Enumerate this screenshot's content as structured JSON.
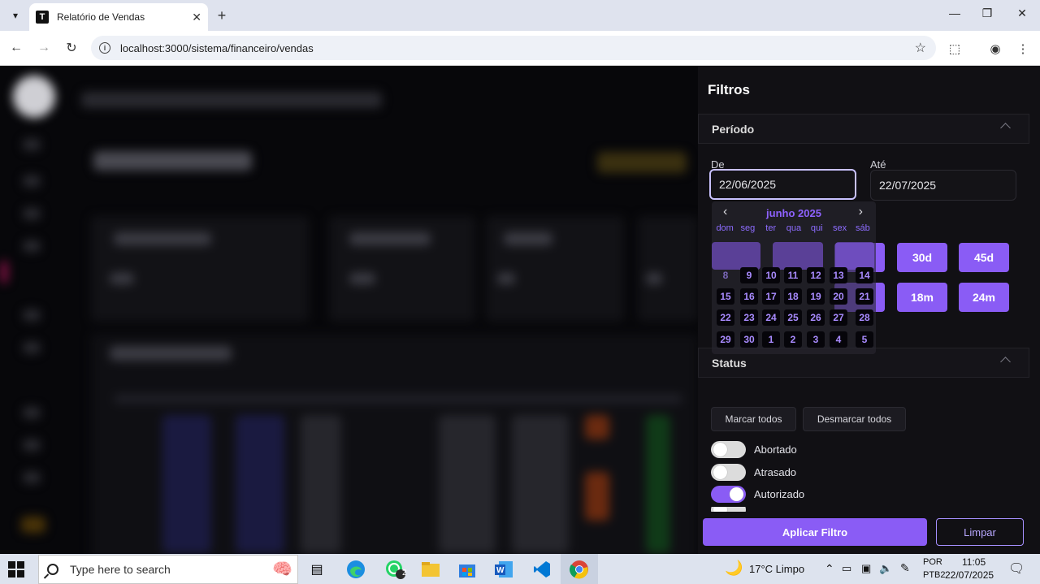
{
  "browser": {
    "tab_title": "Relatório de Vendas",
    "favicon_letter": "T",
    "url": "localhost:3000/sistema/financeiro/vendas"
  },
  "filters": {
    "title": "Filtros",
    "period": {
      "header": "Período",
      "from_label": "De",
      "from_value": "22/06/2025",
      "to_label": "Até",
      "to_value": "22/07/2025",
      "quick_buttons": [
        "30d",
        "45d",
        "18m",
        "24m"
      ]
    },
    "calendar": {
      "month": "junho",
      "year": "2025",
      "weekdays": [
        "dom",
        "seg",
        "ter",
        "qua",
        "qui",
        "sex",
        "sáb"
      ],
      "weeks": [
        [
          "8",
          "9",
          "10",
          "11",
          "12",
          "13",
          "14"
        ],
        [
          "15",
          "16",
          "17",
          "18",
          "19",
          "20",
          "21"
        ],
        [
          "22",
          "23",
          "24",
          "25",
          "26",
          "27",
          "28"
        ],
        [
          "29",
          "30",
          "1",
          "2",
          "3",
          "4",
          "5"
        ]
      ]
    },
    "status": {
      "header": "Status",
      "select_all": "Marcar todos",
      "deselect_all": "Desmarcar todos",
      "items": [
        {
          "label": "Abortado",
          "on": false
        },
        {
          "label": "Atrasado",
          "on": false
        },
        {
          "label": "Autorizado",
          "on": true
        }
      ]
    },
    "apply": "Aplicar Filtro",
    "clear": "Limpar"
  },
  "taskbar": {
    "search_placeholder": "Type here to search",
    "weather": "17°C  Limpo",
    "lang_top": "POR",
    "lang_bottom": "PTB2",
    "time": "11:05",
    "date": "22/07/2025",
    "whatsapp_badge": "2"
  }
}
